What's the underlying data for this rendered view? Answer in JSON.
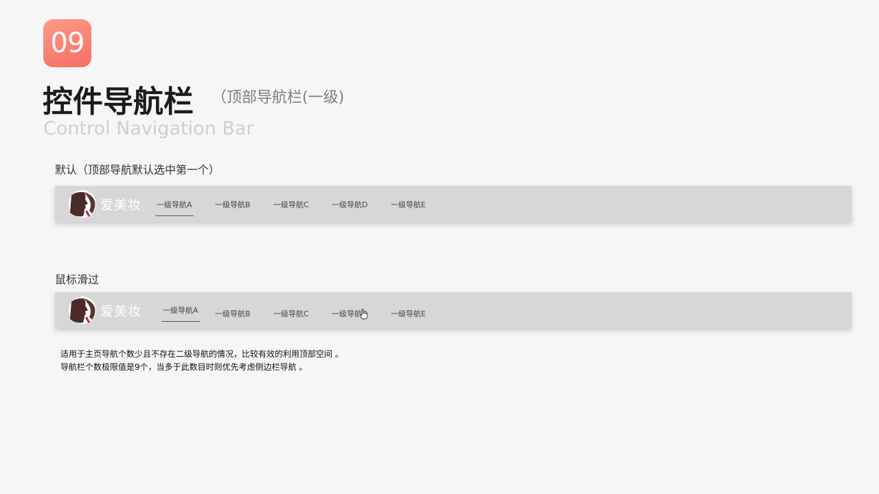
{
  "badge": "09",
  "title": "控件导航栏",
  "subtitle": "（顶部导航栏(一级)",
  "title_en": "Control Navigation Bar",
  "colors": {
    "badge_top": "#ff9a8a",
    "badge_bottom": "#f36f62",
    "navbar_bg": "#d7d7d7",
    "brand_text": "#ffffff"
  },
  "sections": [
    {
      "label": "默认（顶部导航默认选中第一个）",
      "brand": "爱美妆",
      "logo_icon": "woman-profile-lipstick-icon",
      "active_index": 0,
      "items": [
        "一级导航A",
        "一级导航B",
        "一级导航C",
        "一级导航D",
        "一级导航E"
      ]
    },
    {
      "label": "鼠标滑过",
      "brand": "爱美妆",
      "logo_icon": "woman-profile-lipstick-icon",
      "active_index": 0,
      "hover_index": 3,
      "cursor_icon": "hand-pointer-icon",
      "items": [
        "一级导航A",
        "一级导航B",
        "一级导航C",
        "一级导航D",
        "一级导航E"
      ]
    }
  ],
  "description": [
    "适用于主页导航个数少且不存在二级导航的情况，比较有效的利用顶部空间 。",
    "导航栏个数极限值是9个，当多于此数目时则优先考虑侧边栏导航 。"
  ]
}
